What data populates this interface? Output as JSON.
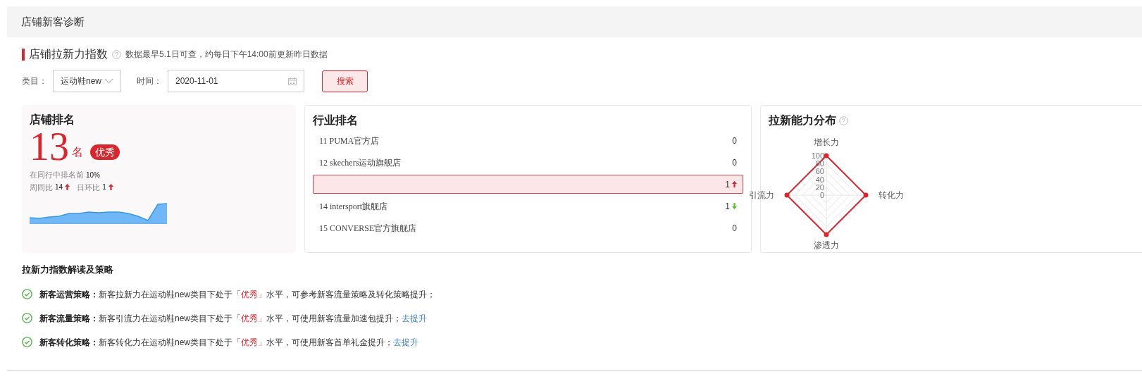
{
  "panel": {
    "title": "店铺新客诊断"
  },
  "section": {
    "title": "店铺拉新力指数",
    "note": "数据最早5.1日可查，约每日下午14:00前更新昨日数据"
  },
  "filters": [
    {
      "kind": "select",
      "label": "类目：",
      "value": "运动鞋new"
    },
    {
      "kind": "date",
      "label": "时间：",
      "value": "2020-11-01"
    }
  ],
  "search_button": "搜索",
  "store_rank": {
    "title": "店铺排名",
    "rank": "13",
    "unit": "名",
    "badge": "优秀",
    "percentile_label": "在同行中排名前",
    "percentile": "10%",
    "changes": [
      {
        "label": "周同比",
        "value": "14",
        "up": true
      },
      {
        "label": "日环比",
        "value": "1",
        "up": true
      }
    ]
  },
  "industry_rank": {
    "title": "行业排名",
    "rows": [
      {
        "name": "11 PUMA官方店",
        "value": "0",
        "up": false,
        "down": false,
        "selected": false
      },
      {
        "name": "12 skechers运动旗舰店",
        "value": "0",
        "up": false,
        "down": false,
        "selected": false
      },
      {
        "value": "1",
        "up": true,
        "down": false,
        "selected": true
      },
      {
        "name": "14 intersport旗舰店",
        "value": "1",
        "up": false,
        "down": true,
        "selected": false
      },
      {
        "name": "15 CONVERSE官方旗舰店",
        "value": "0",
        "up": false,
        "down": false,
        "selected": false
      }
    ]
  },
  "distribution": {
    "title": "拉新能力分布",
    "ticks": [
      "100",
      "80",
      "60",
      "40",
      "20",
      "0"
    ],
    "axes": [
      {
        "label": "增长力"
      },
      {
        "label": "转化力"
      },
      {
        "label": "渗透力"
      },
      {
        "label": "引流力"
      }
    ]
  },
  "strategy": {
    "title": "拉新力指数解读及策略",
    "items": [
      {
        "name": "新客运营策略：",
        "before": "新客拉新力在运动鞋new类目下处于",
        "level": "「优秀」",
        "after": "水平，可参考新客流量策略及转化策略提升；"
      },
      {
        "name": "新客流量策略：",
        "before": "新客引流力在运动鞋new类目下处于",
        "level": "「优秀」",
        "after": "水平，可使用新客流量加速包提升；",
        "link": "去提升"
      },
      {
        "name": "新客转化策略：",
        "before": "新客转化力在运动鞋new类目下处于",
        "level": "「优秀」",
        "after": "水平，可使用新客首单礼金提升；",
        "link": "去提升"
      }
    ]
  }
}
